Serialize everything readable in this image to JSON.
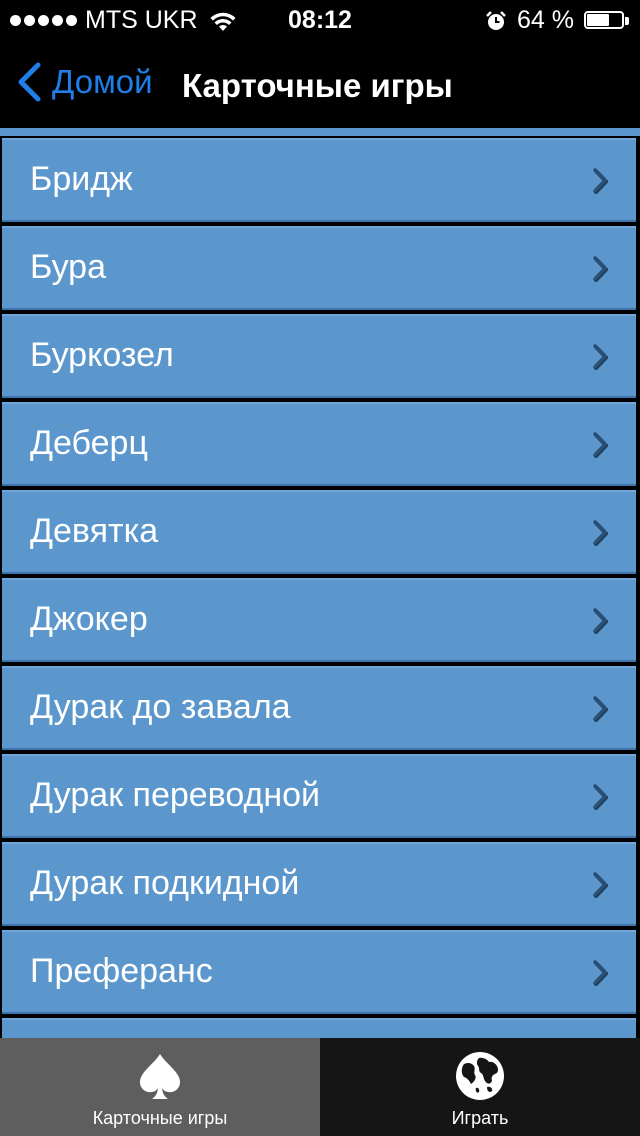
{
  "status_bar": {
    "carrier": "MTS UKR",
    "time": "08:12",
    "battery_percent": "64 %",
    "battery_level": 0.64,
    "signal_bars": 5
  },
  "nav": {
    "back_label": "Домой",
    "title": "Карточные игры"
  },
  "list": {
    "items": [
      {
        "label": "Бридж"
      },
      {
        "label": "Бура"
      },
      {
        "label": "Буркозел"
      },
      {
        "label": "Деберц"
      },
      {
        "label": "Девятка"
      },
      {
        "label": "Джокер"
      },
      {
        "label": "Дурак до завала"
      },
      {
        "label": "Дурак переводной"
      },
      {
        "label": "Дурак подкидной"
      },
      {
        "label": "Преферанс"
      },
      {
        "label": ""
      }
    ]
  },
  "tab_bar": {
    "tabs": [
      {
        "label": "Карточные игры",
        "icon": "spade-icon",
        "active": true
      },
      {
        "label": "Играть",
        "icon": "globe-icon",
        "active": false
      }
    ]
  },
  "colors": {
    "accent": "#1f7ee8",
    "list_item_bg": "#5b96cc",
    "active_tab_bg": "#5e5e5e",
    "inactive_tab_bg": "#151515"
  }
}
